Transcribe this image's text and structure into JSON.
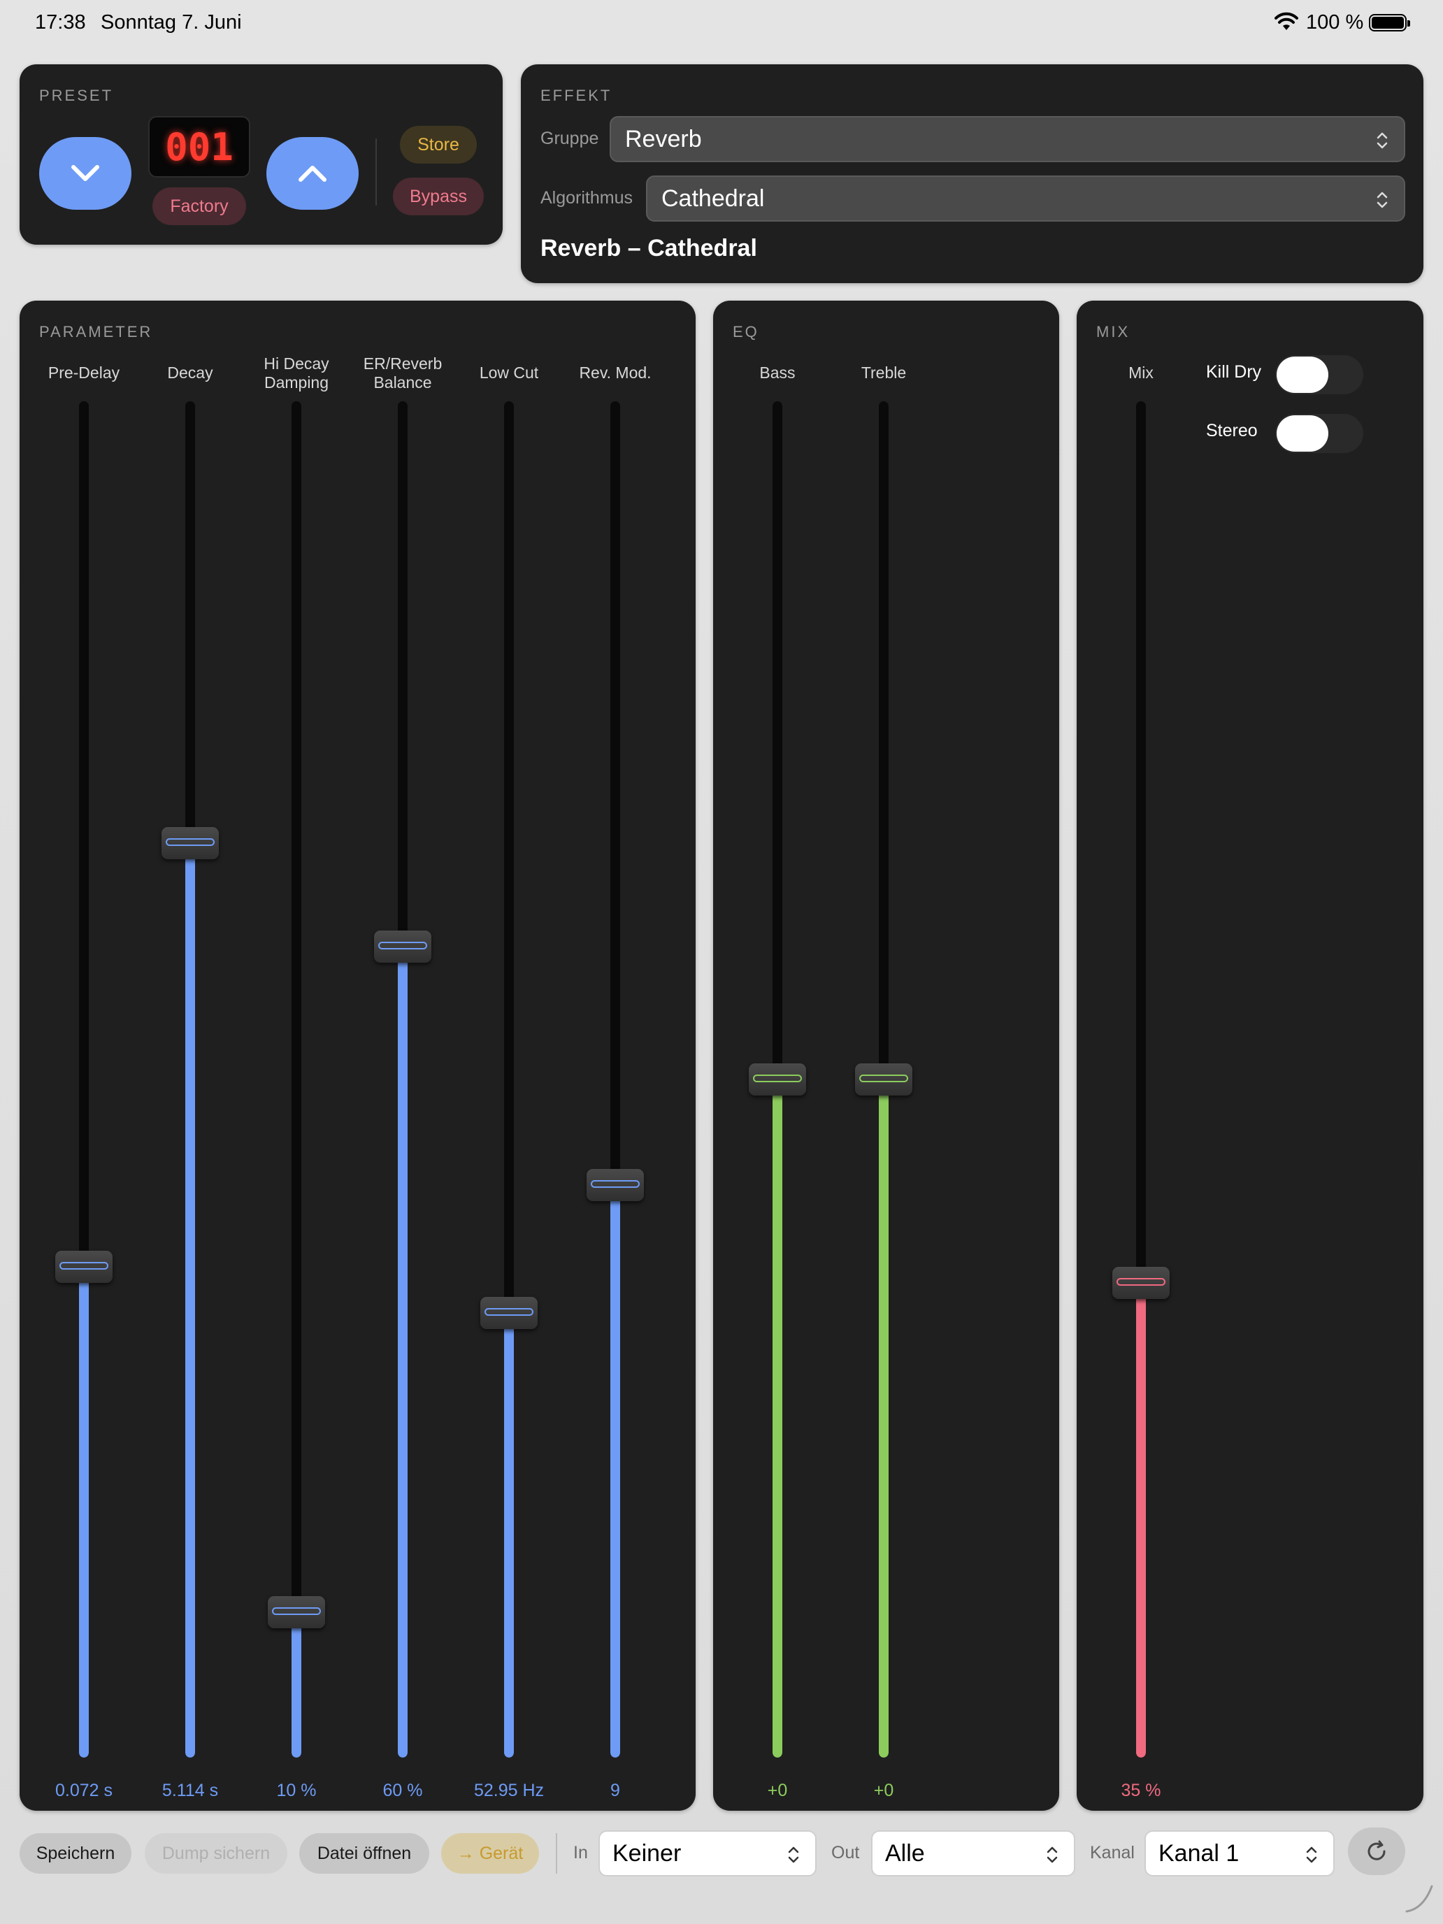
{
  "status": {
    "time": "17:38",
    "date": "Sonntag 7. Juni",
    "battery": "100 %"
  },
  "preset": {
    "title": "PRESET",
    "number": "001",
    "bank": "Factory",
    "store": "Store",
    "bypass": "Bypass"
  },
  "effekt": {
    "title": "EFFEKT",
    "group_label": "Gruppe",
    "group_value": "Reverb",
    "algo_label": "Algorithmus",
    "algo_value": "Cathedral",
    "summary": "Reverb – Cathedral"
  },
  "parameter": {
    "title": "PARAMETER",
    "sliders": [
      {
        "label": "Pre-Delay",
        "value": "0.072 s",
        "level": 0.362
      },
      {
        "label": "Decay",
        "value": "5.114 s",
        "level": 0.674
      },
      {
        "label": "Hi Decay Damping",
        "value": "10 %",
        "level": 0.107
      },
      {
        "label": "ER/Reverb Balance",
        "value": "60 %",
        "level": 0.598
      },
      {
        "label": "Low Cut",
        "value": "52.95 Hz",
        "level": 0.328
      },
      {
        "label": "Rev. Mod.",
        "value": "9",
        "level": 0.422
      }
    ]
  },
  "eq": {
    "title": "EQ",
    "sliders": [
      {
        "label": "Bass",
        "value": "+0",
        "level": 0.5
      },
      {
        "label": "Treble",
        "value": "+0",
        "level": 0.5
      }
    ]
  },
  "mix": {
    "title": "MIX",
    "slider": {
      "label": "Mix",
      "value": "35 %",
      "level": 0.35
    },
    "kill_dry": {
      "label": "Kill Dry",
      "on": false
    },
    "stereo": {
      "label": "Stereo",
      "on": false
    }
  },
  "bottom": {
    "save": "Speichern",
    "dump": "Dump sichern",
    "open": "Datei öffnen",
    "send": "→ Gerät",
    "in_label": "In",
    "in_value": "Keiner",
    "out_label": "Out",
    "out_value": "Alle",
    "kanal_label": "Kanal",
    "kanal_value": "Kanal 1"
  },
  "colors": {
    "blue": "#6e9bf5",
    "green": "#8ccc5c",
    "red": "#f06a80",
    "lcd": "#ff3b30"
  }
}
